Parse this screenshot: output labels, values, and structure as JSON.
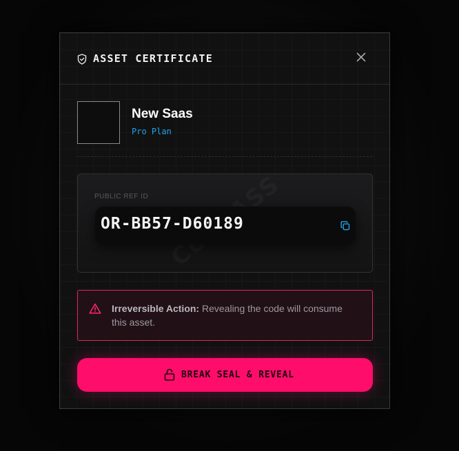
{
  "modal": {
    "title": "ASSET CERTIFICATE",
    "icons": {
      "header": "shield-check-icon",
      "close": "close-icon"
    }
  },
  "product": {
    "name": "New Saas",
    "plan": "Pro Plan",
    "thumbnail": "product-thumbnail"
  },
  "reference": {
    "label": "PUBLIC REF ID",
    "code": "OR-BB57-D60189",
    "watermark": "CURLASS",
    "copy_icon": "copy-icon"
  },
  "warning": {
    "title": "Irreversible Action:",
    "message": " Revealing the code will consume this asset.",
    "icon": "alert-triangle-icon"
  },
  "action": {
    "label": "BREAK SEAL & REVEAL",
    "icon": "unlock-icon"
  },
  "colors": {
    "accent": "#ff0d6a",
    "plan": "#1fa4e8",
    "warning_border": "#e0245e"
  }
}
